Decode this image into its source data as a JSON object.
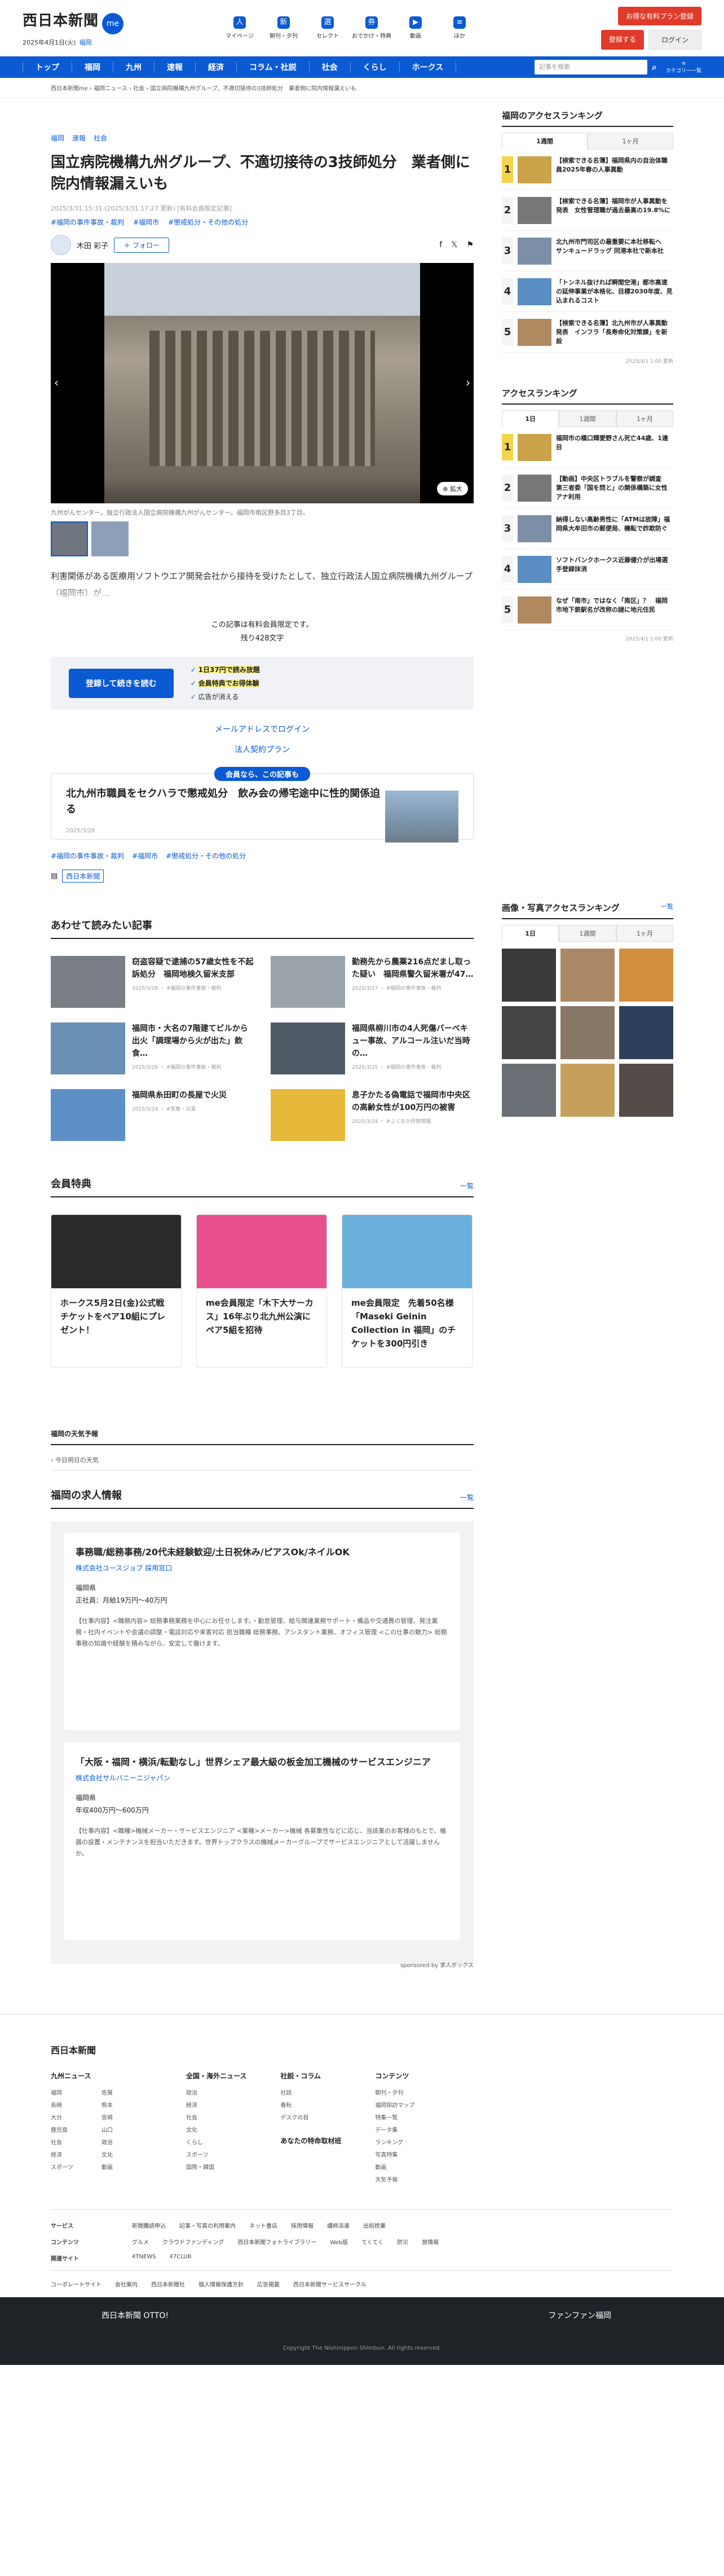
{
  "header": {
    "logo": "西日本新聞",
    "me": "me",
    "date": "2025年4月1日(火)",
    "region": "福岡",
    "icons": [
      {
        "label": "マイページ",
        "icon": "user-icon",
        "g": "人"
      },
      {
        "label": "朝刊・夕刊",
        "icon": "newspaper-icon",
        "g": "新"
      },
      {
        "label": "セレクト",
        "icon": "select-icon",
        "g": "選"
      },
      {
        "label": "おでかけ・特典",
        "icon": "ticket-icon",
        "g": "券"
      },
      {
        "label": "動画",
        "icon": "video-icon",
        "g": "▶"
      },
      {
        "label": "ほか",
        "icon": "more-icon",
        "g": "≡"
      }
    ],
    "plan_btn": "お得な有料プラン登録",
    "register": "登録する",
    "login": "ログイン"
  },
  "nav": {
    "items": [
      "トップ",
      "福岡",
      "九州",
      "速報",
      "経済",
      "コラム・社説",
      "社会",
      "くらし",
      "ホークス"
    ],
    "search_placeholder": "記事を検索",
    "menu": "カテゴリー一覧"
  },
  "breadcrumb": [
    "西日本新聞me",
    "福岡ニュース",
    "社会",
    "国立病院機構九州グループ、不適切接待の3技師処分　業者側に院内情報漏えいも"
  ],
  "article": {
    "tags": [
      "福岡",
      "速報",
      "社会"
    ],
    "title": "国立病院機構九州グループ、不適切接待の3技師処分　業者側に院内情報漏えいも",
    "date": "2025/3/31 15:31 (2025/3/31 17:27 更新) [有料会員限定記事]",
    "topic_tags": [
      "#福岡の事件事故・裁判",
      "#福岡市",
      "#懲戒処分・その他の処分"
    ],
    "author": "木田 彩子",
    "follow": "＋ フォロー",
    "zoom": "拡大",
    "caption": "九州がんセンター。独立行政法人国立病院機構九州がんセンター。福岡市南区野多目3丁目。",
    "lead": "利害関係がある医療用ソフトウエア開発会社から接待を受けたとして、独立行政法人国立病院機構九州グループ（福岡市）が…",
    "paid_note": "この記事は有料会員限定です。",
    "remaining": "残り428文字",
    "reg_btn": "登録して続きを読む",
    "benefits": [
      "1日37円で読み放題",
      "会員特典でお得体験",
      "広告が消える"
    ],
    "email_login": "メールアドレスでログイン",
    "corp_plan": "法人契約プラン",
    "member_badge": "会員なら、この記事も",
    "member_title": "北九州市職員をセクハラで懲戒処分　飲み会の帰宅途中に性的関係迫る",
    "member_date": "2025/3/28",
    "bottom_tags": [
      "#福岡の事件事故・裁判",
      "#福岡市",
      "#懲戒処分・その他の処分"
    ],
    "source": "西日本新聞"
  },
  "related": {
    "title": "あわせて読みたい記事",
    "items": [
      {
        "t": "窃盗容疑で逮捕の57歳女性を不起訴処分　福岡地検久留米支部",
        "m": "2025/3/28 ・ #福岡の事件事故・裁判"
      },
      {
        "t": "勤務先から農薬216点だまし取った疑い　福岡県警久留米署が47…",
        "m": "2025/3/27 ・ #福岡の事件事故・裁判"
      },
      {
        "t": "福岡市・大名の7階建てビルから出火「調理場から火が出た」飲食…",
        "m": "2025/3/26 ・ #福岡の事件事故・裁判"
      },
      {
        "t": "福岡県柳川市の4人死傷バーベキュー事故、アルコール注いだ当時の…",
        "m": "2025/3/25 ・ #福岡の事件事故・裁判"
      },
      {
        "t": "福岡県糸田町の長屋で火災",
        "m": "2025/3/24 ・ #気象・災害"
      },
      {
        "t": "息子かたる偽電話で福岡市中央区の高齢女性が100万円の被害",
        "m": "2025/3/24 ・ #ふくおか詐欺情報"
      }
    ]
  },
  "perks": {
    "title": "会員特典",
    "more": "一覧",
    "items": [
      "ホークス5月2日(金)公式戦チケットをペア10組にプレゼント！",
      "me会員限定「木下大サーカス」16年ぶり北九州公演にペア5組を招待",
      "me会員限定　先着50名様「Maseki Geinin Collection in 福岡」のチケットを300円引き"
    ]
  },
  "weather": {
    "title": "福岡の天気予報",
    "sub": "今日明日の天気"
  },
  "jobs": {
    "title": "福岡の求人情報",
    "more": "一覧",
    "items": [
      {
        "t": "事務職/総務事務/20代未経験歓迎/土日祝休み/ピアスOk/ネイルOK",
        "co": "株式会社ユースジョブ 採用窓口",
        "loc": "福岡県",
        "pay": "正社員：月給19万円〜40万円",
        "d": "【仕事内容】<職務内容> 総務事務業務を中心にお任せします。・勤怠管理、給与関連業務サポート・備品や交通費の管理、発注業務・社内イベントや会議の調整・電話対応や来客対応 担当職種 総務事務、アシスタント業務、オフィス管理 <この仕事の魅力> 総務事務の知識や経験を積みながら、安定して働けます。"
      },
      {
        "t": "「大阪・福岡・横浜/転勤なし」世界シェア最大級の板金加工機械のサービスエンジニア",
        "co": "株式会社サルバニーニジャパン",
        "loc": "福岡県",
        "pay": "年収400万円〜600万円",
        "d": "【仕事内容】<職種>機械メーカー・サービスエンジニア <業種>メーカー>機械 各募集性などに応じ、当該業のお客様のもとで、機器の設置・メンテナンスを担当いただきます。世界トップクラスの機械メーカーグループでサービスエンジニアとして活躍しませんか。"
      }
    ],
    "powered": "sponsored by 求人ボックス"
  },
  "sidebar": {
    "access_title": "福岡のアクセスランキング",
    "tabs1": [
      "1週間",
      "1ヶ月"
    ],
    "rank1": [
      "【検索できる名簿】福岡県内の自治体職員2025年春の人事異動",
      "【検索できる名簿】福岡市が人事異動を発表　女性管理職が過去最高の19.8%に",
      "北九州市門司区の最重要に本社移転へ　サンキュードラッグ 同港本社で新本社",
      "「トンネル抜ければ瞬間空港」都市高速の延伸事業が本格化、目標2030年度、見込まれるコスト",
      "【検索できる名簿】北九州市が人事異動発表　インフラ「長寿命化対策課」を新設"
    ],
    "upd1": "2025/4/1 1:00 更新",
    "access2_title": "アクセスランキング",
    "tabs2": [
      "1日",
      "1週間",
      "1ヶ月"
    ],
    "rank2": [
      "福岡市の橋口輝愛野さん死亡44歳、1連目",
      "【動画】中央区トラブルを警察が調査　第三者委「国を問と」の関係構築に女性アナ利用",
      "納得しない高齢男性に「ATMは故障」福岡県大牟田市の郵便局、機転で詐欺防ぐ",
      "ソフトバンクホークス近藤健介が出場選手登録抹消",
      "なぜ「南市」ではなく「南区」？　福岡市地下鉄駅名が改称の謎に地元住民"
    ],
    "upd2": "2025/4/1 1:00 更新",
    "img_title": "画像・写真アクセスランキング",
    "img_more": "一覧",
    "tabs3": [
      "1日",
      "1週間",
      "1ヶ月"
    ]
  },
  "footer": {
    "logo": "西日本新聞",
    "cols": [
      {
        "h": "九州ニュース",
        "items": [
          "福岡",
          "佐賀",
          "長崎",
          "熊本",
          "大分",
          "宮崎",
          "鹿児島",
          "山口",
          "社会",
          "政治",
          "経済",
          "文化",
          "スポーツ",
          "動画"
        ]
      },
      {
        "h": "全国・海外ニュース",
        "items": [
          "政治",
          "経済",
          "社会",
          "文化",
          "くらし",
          "スポーツ",
          "国際・韓国"
        ]
      },
      {
        "h": "社説・コラム",
        "items": [
          "社説",
          "春秋",
          "デスクの目"
        ]
      },
      {
        "h": "コンテンツ",
        "items": [
          "朝刊・夕刊",
          "福岡探訪マップ",
          "特集一覧",
          "データ集",
          "ランキング",
          "写真特集",
          "動画",
          "天気予報"
        ]
      }
    ],
    "sub_h": "あなたの特命取材班",
    "rows": [
      {
        "h": "サービス",
        "items": [
          "新聞購読申込",
          "記事・写真の利用案内",
          "ネット書店",
          "採用情報",
          "講師派遣",
          "出前授業"
        ]
      },
      {
        "h": "コンテンツ",
        "items": [
          "グルメ",
          "クラウドファンディング",
          "西日本新聞フォトライブラリー",
          "Web版",
          "てくてく",
          "防災",
          "旅情報"
        ]
      },
      {
        "h": "関連サイト",
        "items": [
          "4TNEWS",
          "47CLUB"
        ]
      }
    ],
    "corp": [
      "コーポレートサイト",
      "会社案内",
      "西日本新聞社",
      "個人情報保護方針",
      "広告掲載",
      "西日本新聞サービスサークル"
    ],
    "copyright": "Copyright The Nishinippon Shimbun. All rights reserved.",
    "ds": "西日本新聞 OTTO!",
    "fa": "ファンファン福岡"
  }
}
